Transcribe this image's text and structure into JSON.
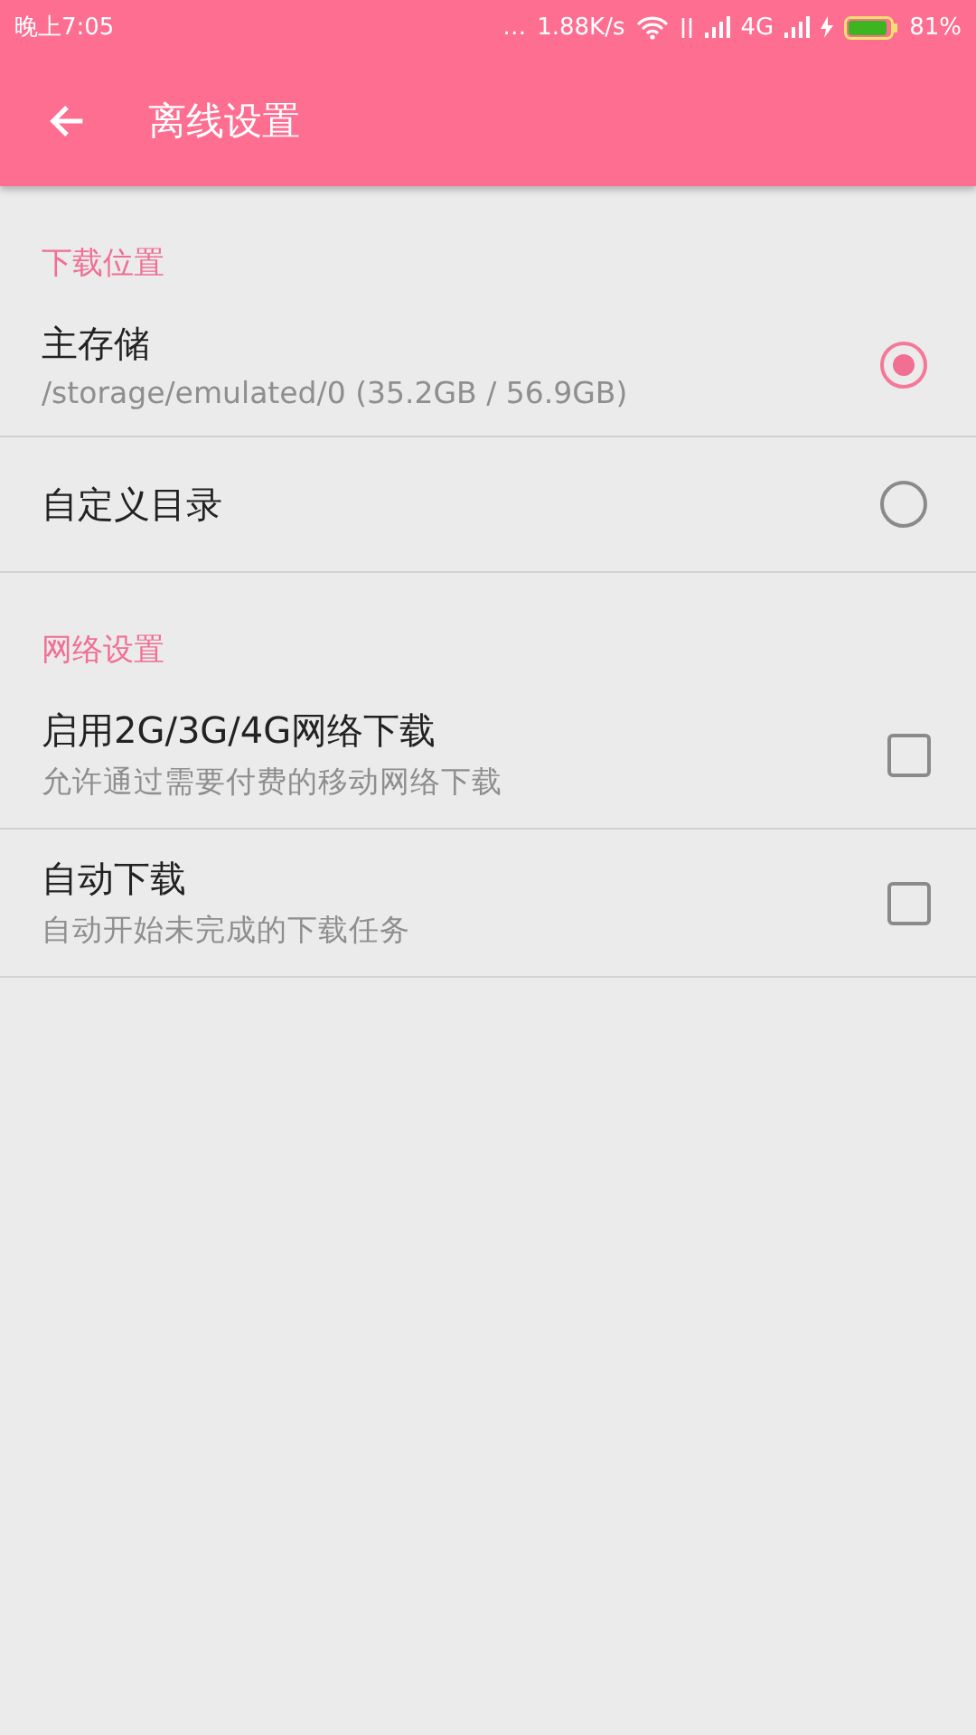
{
  "status_bar": {
    "time": "晚上7:05",
    "dots": "…",
    "speed": "1.88K/s",
    "network": "4G",
    "battery": "81%"
  },
  "app_bar": {
    "title": "离线设置"
  },
  "sections": [
    {
      "header": "下载位置",
      "items": [
        {
          "kind": "radio",
          "title": "主存储",
          "subtitle": "/storage/emulated/0 (35.2GB / 56.9GB)",
          "selected": true
        },
        {
          "kind": "radio",
          "title": "自定义目录",
          "selected": false
        }
      ]
    },
    {
      "header": "网络设置",
      "items": [
        {
          "kind": "checkbox",
          "title": "启用2G/3G/4G网络下载",
          "subtitle": "允许通过需要付费的移动网络下载",
          "checked": false
        },
        {
          "kind": "checkbox",
          "title": "自动下载",
          "subtitle": "自动开始未完成的下载任务",
          "checked": false
        }
      ]
    }
  ]
}
